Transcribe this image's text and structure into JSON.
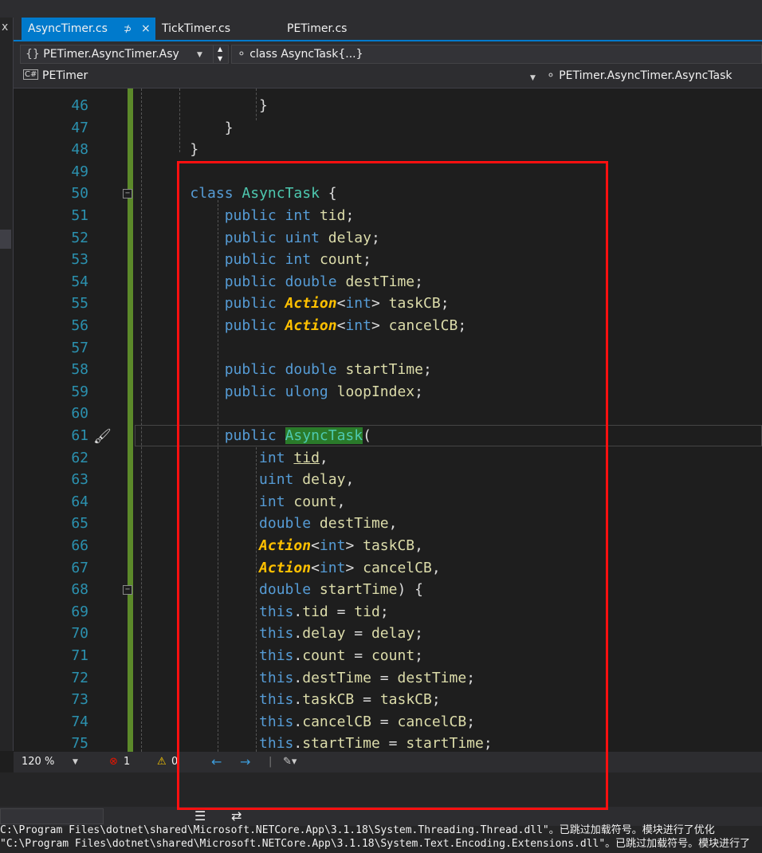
{
  "tabs": [
    {
      "label": "AsyncTimer.cs",
      "active": true,
      "pin": "⊅",
      "close": "×"
    },
    {
      "label": "TickTimer.cs",
      "active": false
    },
    {
      "label": "PETimer.cs",
      "active": false
    }
  ],
  "left_panel": {
    "close": "x"
  },
  "nav": {
    "project_combo": "PETimer.AsyncTimer.Asy",
    "member_combo": "class AsyncTask{...}",
    "scope_left": "PETimer",
    "scope_right": "PETimer.AsyncTimer.AsyncTask"
  },
  "editor": {
    "lines": [
      {
        "n": "46",
        "t": "            }"
      },
      {
        "n": "47",
        "t": "        }"
      },
      {
        "n": "48",
        "t": "    }"
      },
      {
        "n": "49",
        "t": ""
      },
      {
        "n": "50",
        "t": "    class AsyncTask {"
      },
      {
        "n": "51",
        "t": "        public int tid;"
      },
      {
        "n": "52",
        "t": "        public uint delay;"
      },
      {
        "n": "53",
        "t": "        public int count;"
      },
      {
        "n": "54",
        "t": "        public double destTime;"
      },
      {
        "n": "55",
        "t": "        public Action<int> taskCB;"
      },
      {
        "n": "56",
        "t": "        public Action<int> cancelCB;"
      },
      {
        "n": "57",
        "t": ""
      },
      {
        "n": "58",
        "t": "        public double startTime;"
      },
      {
        "n": "59",
        "t": "        public ulong loopIndex;"
      },
      {
        "n": "60",
        "t": ""
      },
      {
        "n": "61",
        "t": "        public AsyncTask("
      },
      {
        "n": "62",
        "t": "            int tid,"
      },
      {
        "n": "63",
        "t": "            uint delay,"
      },
      {
        "n": "64",
        "t": "            int count,"
      },
      {
        "n": "65",
        "t": "            double destTime,"
      },
      {
        "n": "66",
        "t": "            Action<int> taskCB,"
      },
      {
        "n": "67",
        "t": "            Action<int> cancelCB,"
      },
      {
        "n": "68",
        "t": "            double startTime) {"
      },
      {
        "n": "69",
        "t": "            this.tid = tid;"
      },
      {
        "n": "70",
        "t": "            this.delay = delay;"
      },
      {
        "n": "71",
        "t": "            this.count = count;"
      },
      {
        "n": "72",
        "t": "            this.destTime = destTime;"
      },
      {
        "n": "73",
        "t": "            this.taskCB = taskCB;"
      },
      {
        "n": "74",
        "t": "            this.cancelCB = cancelCB;"
      },
      {
        "n": "75",
        "t": "            this.startTime = startTime;"
      }
    ]
  },
  "status": {
    "zoom": "120 %",
    "errors": "1",
    "warnings": "0",
    "back_arrow": "←",
    "forward_arrow": "→"
  },
  "output": {
    "line1": "C:\\Program Files\\dotnet\\shared\\Microsoft.NETCore.App\\3.1.18\\System.Threading.Thread.dll\"。已跳过加载符号。模块进行了优化",
    "line2": "\"C:\\Program Files\\dotnet\\shared\\Microsoft.NETCore.App\\3.1.18\\System.Text.Encoding.Extensions.dll\"。已跳过加载符号。模块进行了"
  },
  "colors": {
    "accent": "#007acc",
    "keyword": "#569cd6",
    "type": "#4ec9b0",
    "identifier": "#dcdcaa",
    "action_type": "#ffc000",
    "line_number": "#2b91af",
    "annotation_box": "#ff1010"
  }
}
